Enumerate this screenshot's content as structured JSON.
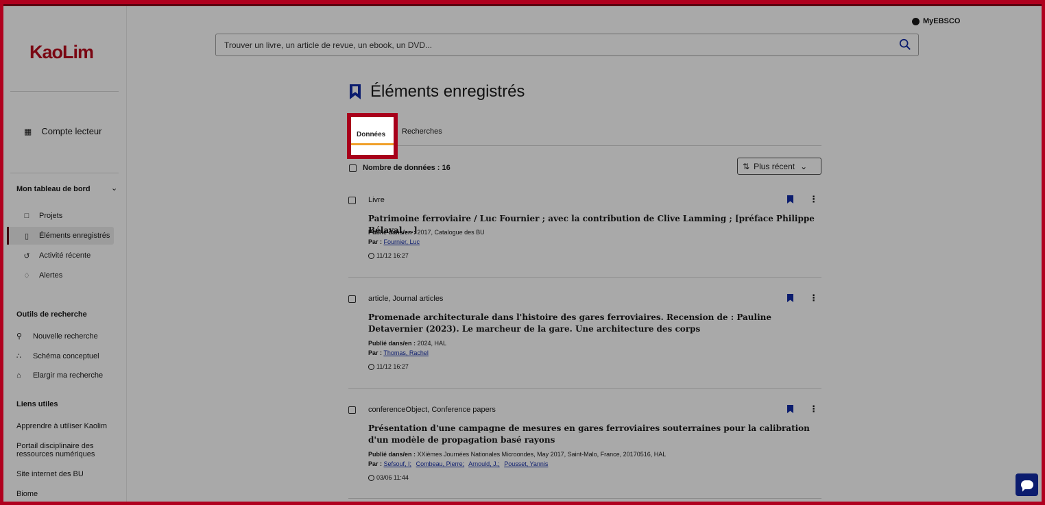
{
  "sidebar": {
    "logo": "KaoLim",
    "account_label": "Compte lecteur",
    "dashboard_title": "Mon tableau de bord",
    "dashboard_items": [
      {
        "label": "Projets",
        "icon": "folder-icon"
      },
      {
        "label": "Éléments enregistrés",
        "icon": "bookmark-icon"
      },
      {
        "label": "Activité récente",
        "icon": "history-icon"
      },
      {
        "label": "Alertes",
        "icon": "bell-icon"
      }
    ],
    "tools_title": "Outils de recherche",
    "tools_items": [
      {
        "label": "Nouvelle recherche",
        "icon": "search-icon"
      },
      {
        "label": "Schéma conceptuel",
        "icon": "concept-map-icon"
      },
      {
        "label": "Elargir ma recherche",
        "icon": "library-icon"
      }
    ],
    "links_title": "Liens utiles",
    "links": [
      "Apprendre à utiliser Kaolim",
      "Portail disciplinaire des ressources numériques",
      "Site internet des BU",
      "Biome"
    ]
  },
  "header": {
    "myebsco": "MyEBSCO",
    "search_placeholder": "Trouver un livre, un article de revue, un ebook, un DVD..."
  },
  "main": {
    "title": "Éléments enregistrés",
    "tabs": [
      {
        "label": "Données",
        "active": true
      },
      {
        "label": "Recherches",
        "active": false
      }
    ],
    "count_label": "Nombre de données : 16",
    "sort_label": "Plus récent",
    "results": [
      {
        "type": "Livre",
        "title": "Patrimoine ferroviaire / Luc Fournier ; avec la contribution de Clive Lamming ; [préface Philippe Bélaval,...]",
        "published_label": "Publié dans/en :",
        "published": "2017, Catalogue des BU",
        "by_label": "Par :",
        "authors": [
          "Fournier, Luc"
        ],
        "time": "11/12 16:27"
      },
      {
        "type": "article, Journal articles",
        "title": "Promenade architecturale dans l'histoire des gares ferroviaires. Recension de : Pauline Detavernier (2023). Le marcheur de la gare. Une architecture des corps",
        "published_label": "Publié dans/en :",
        "published": "2024, HAL",
        "by_label": "Par :",
        "authors": [
          "Thomas, Rachel"
        ],
        "time": "11/12 16:27"
      },
      {
        "type": "conferenceObject, Conference papers",
        "title": "Présentation d'une campagne de mesures en gares ferroviaires souterraines pour la calibration d'un modèle de propagation basé rayons",
        "published_label": "Publié dans/en :",
        "published": "XXièmes Journées Nationales Microondes, May 2017, Saint-Malo, France, 20170516, HAL",
        "by_label": "Par :",
        "authors": [
          "Sefsouf, I;",
          "Combeau, Pierre;",
          "Arnould, J.;",
          "Pousset, Yannis"
        ],
        "time": "03/06 11:44"
      }
    ]
  },
  "colors": {
    "brand": "#7a0612",
    "highlight": "#a8001b",
    "accent": "#0b1c6e",
    "tab_underline": "#f0a02a"
  }
}
